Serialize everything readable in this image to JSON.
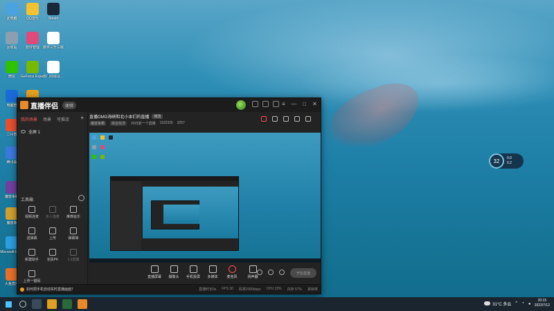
{
  "desktop": {
    "icons": [
      {
        "label": "此电脑",
        "color": "#4aa3e0"
      },
      {
        "label": "QQ音乐",
        "color": "#f2c230"
      },
      {
        "label": "Steam",
        "color": "#1b2838"
      },
      {
        "label": "回收站",
        "color": "#8aa0b0"
      },
      {
        "label": "软件管理",
        "color": "#e04a7a"
      },
      {
        "label": "数学三升三级",
        "color": "#ffffff"
      },
      {
        "label": "微信",
        "color": "#2dc100"
      },
      {
        "label": "GeForce Experience",
        "color": "#76b900"
      },
      {
        "label": "省门局综合…",
        "color": "#ffffff"
      },
      {
        "label": "电脑管",
        "color": "#1a6ad8"
      },
      {
        "label": "",
        "color": "#e8a020"
      },
      {
        "label": "二月管",
        "color": "#e85030"
      },
      {
        "label": "腾讯会",
        "color": "#3a7ae0"
      },
      {
        "label": "魔兽争霸",
        "color": "#7040a0"
      },
      {
        "label": "魔兽争",
        "color": "#d0a030"
      },
      {
        "label": "Microsoft Edge",
        "color": "#2aa0e0"
      },
      {
        "label": "火鱼直播",
        "color": "#e8702a"
      }
    ]
  },
  "speed_widget": {
    "percent": "32",
    "up": "0.0",
    "down": "0.2"
  },
  "app": {
    "title": "直播伴侣",
    "version": "体验",
    "sidebar": {
      "tabs": [
        "我的场景",
        "场景",
        "可推流"
      ],
      "add": "+",
      "scene": "全屏 1",
      "tools_title": "工具箱",
      "tools": [
        {
          "label": "视频连麦"
        },
        {
          "label": "多人连麦"
        },
        {
          "label": "推荐给乐"
        },
        {
          "label": "送弹幕"
        },
        {
          "label": "上传"
        },
        {
          "label": "弹幕等"
        },
        {
          "label": "新建助手"
        },
        {
          "label": "全民PK"
        },
        {
          "label": "1.0直播"
        },
        {
          "label": "上传一键码"
        }
      ]
    },
    "stream": {
      "title": "直播OMG海峡和北小本们的直播",
      "edit": "修改",
      "tag1": "魔兽争霸",
      "tag2": "综合玩法",
      "meta1": "20日前一个直播",
      "meta2": "1102326",
      "meta3": "3257"
    },
    "controls": [
      {
        "label": "直播屏幕"
      },
      {
        "label": "摄像头"
      },
      {
        "label": "手机投屏"
      },
      {
        "label": "多媒体"
      },
      {
        "label": "麦克风"
      },
      {
        "label": "扬声器"
      }
    ],
    "start_button": "开始直播",
    "status": {
      "notice": "如何把手机自动实时直播画面？",
      "stats": [
        "直播时长0s",
        "FPS 30",
        "码率2000kbps",
        "CPU 23%",
        "内存 57%",
        "丢帧率"
      ]
    }
  },
  "taskbar": {
    "weather": "31°C 多云",
    "time": "20:15",
    "date": "2022/7/12"
  }
}
